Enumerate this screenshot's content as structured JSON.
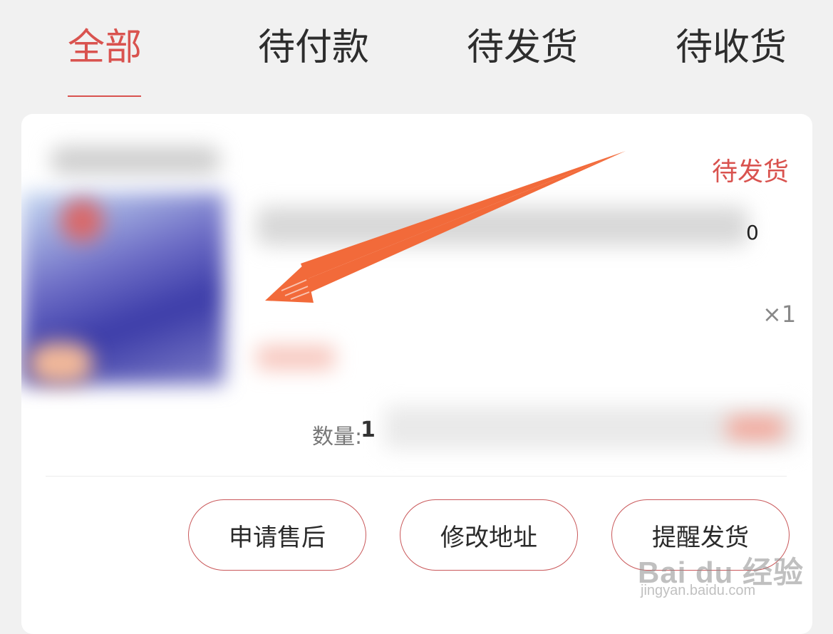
{
  "tabs": [
    {
      "label": "全部",
      "active": true
    },
    {
      "label": "待付款",
      "active": false
    },
    {
      "label": "待发货",
      "active": false
    },
    {
      "label": "待收货",
      "active": false
    }
  ],
  "order": {
    "status": "待发货",
    "price_fragment": "0",
    "count": "×1",
    "quantity_label": "数量:",
    "quantity_value": "1"
  },
  "actions": {
    "after_sales": "申请售后",
    "modify_address": "修改地址",
    "remind_shipping": "提醒发货"
  },
  "watermark": {
    "brand": "Bai du 经验",
    "url": "jingyan.baidu.com"
  },
  "colors": {
    "accent": "#d9534f",
    "annotation_arrow": "#f26a3a"
  }
}
